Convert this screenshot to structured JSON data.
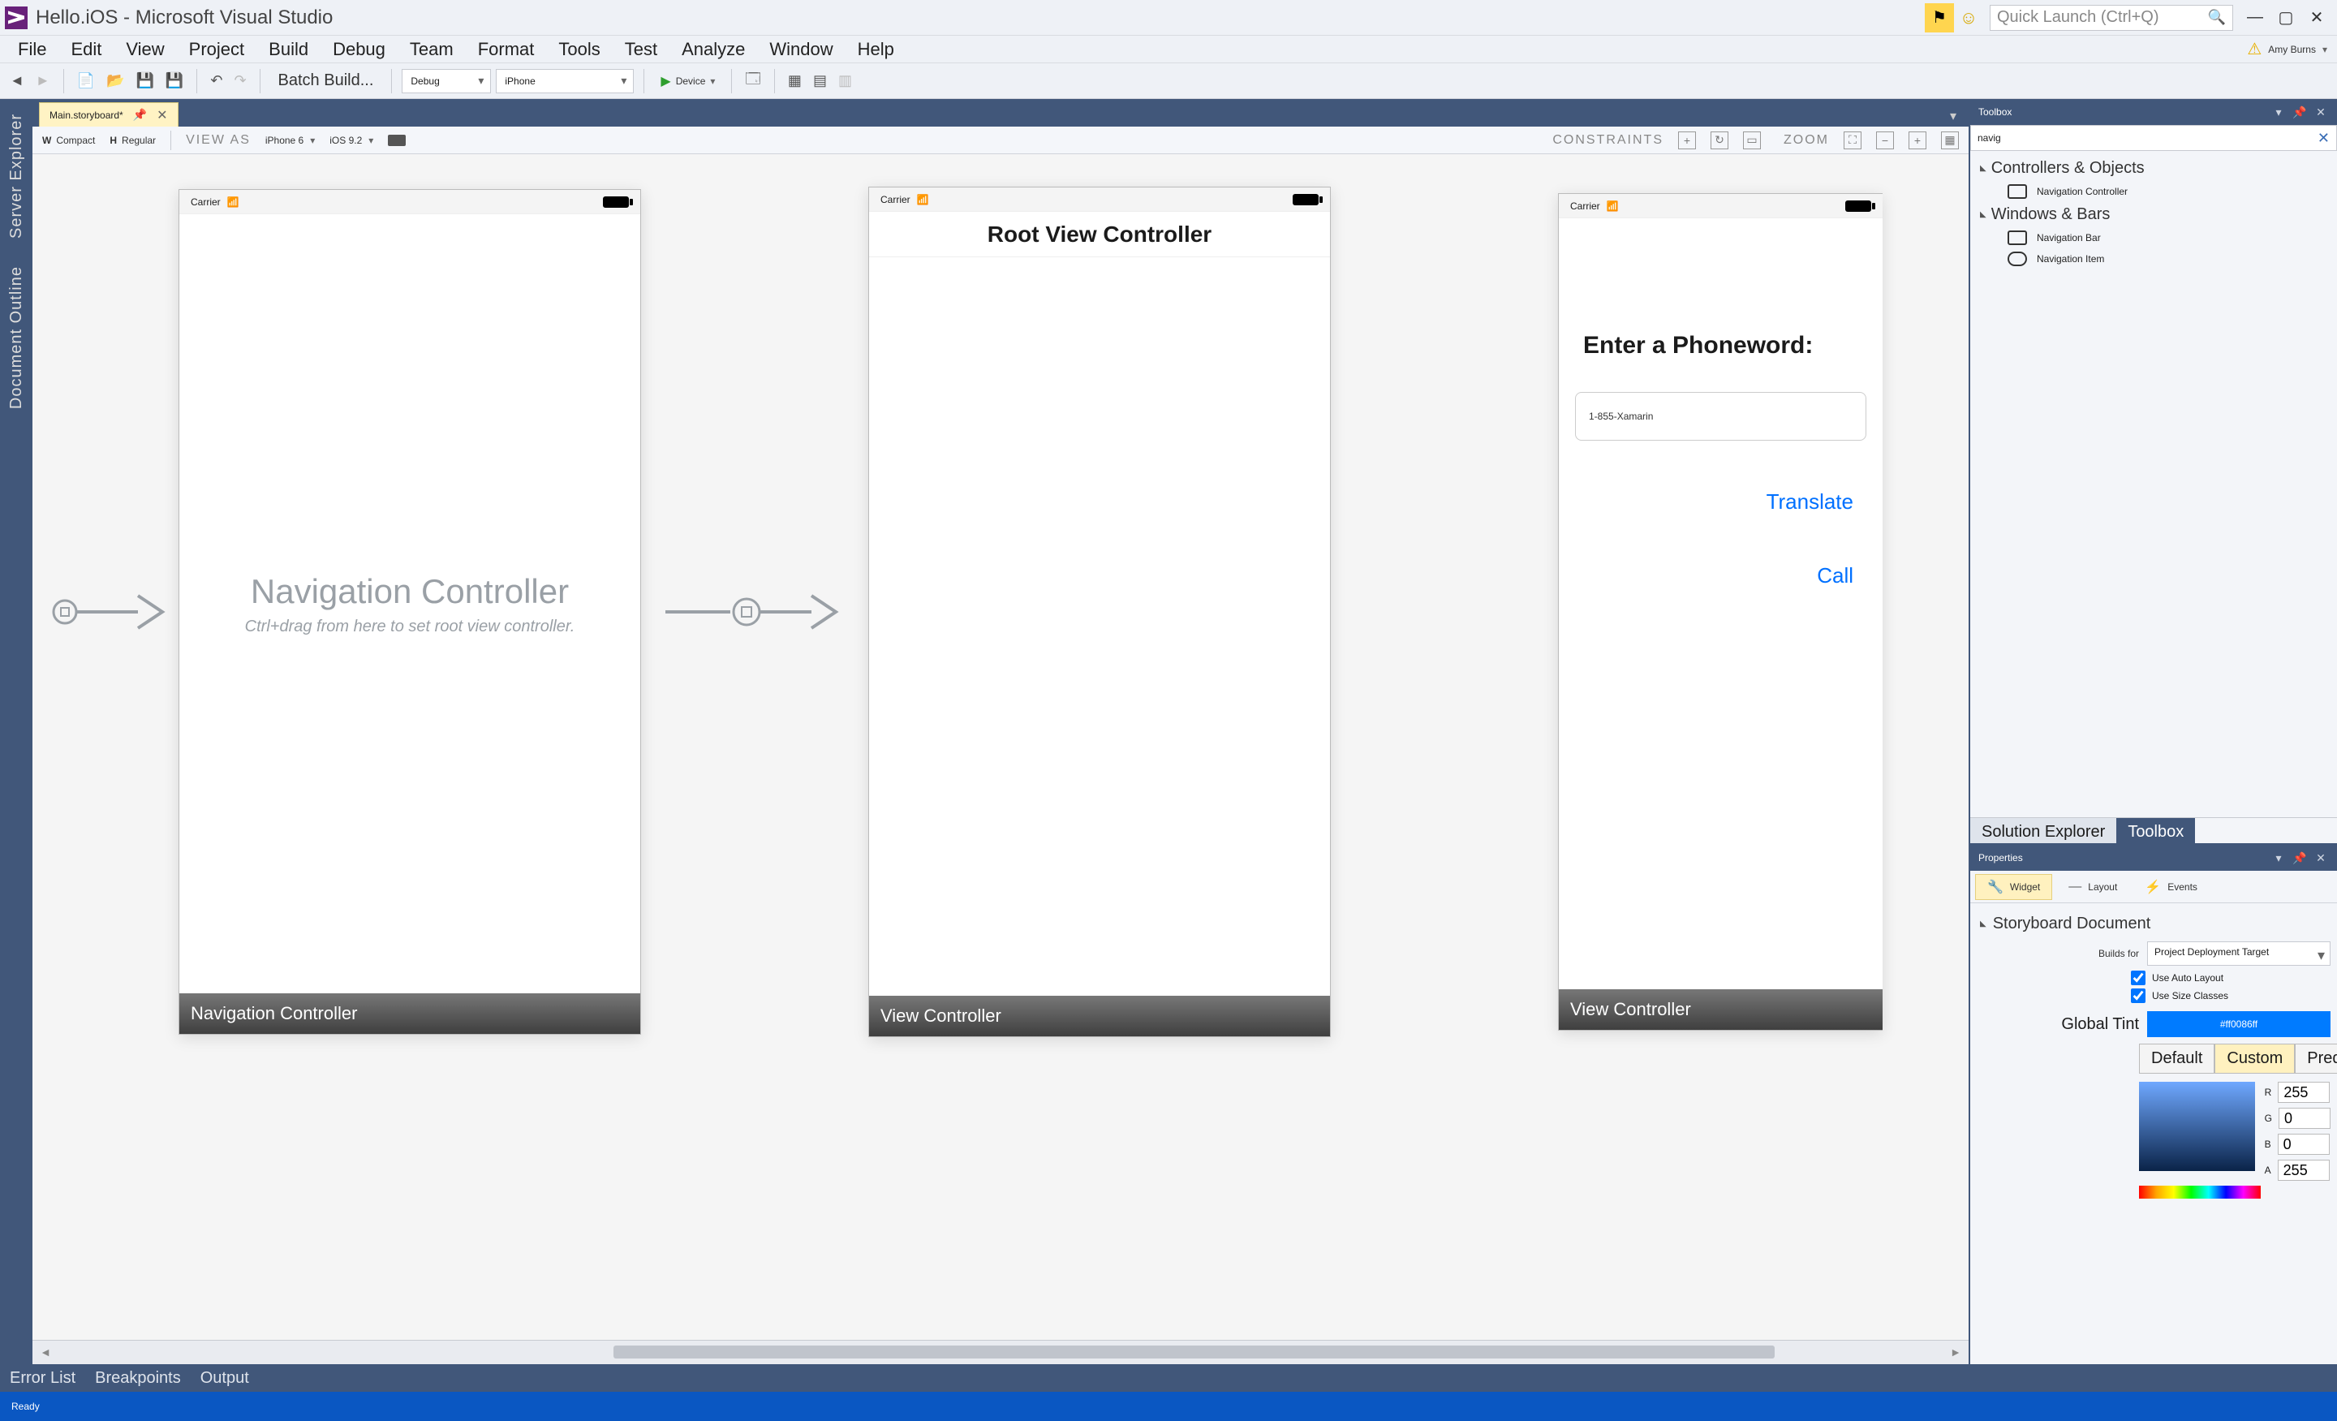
{
  "titlebar": {
    "title": "Hello.iOS - Microsoft Visual Studio",
    "quicklaunch_placeholder": "Quick Launch (Ctrl+Q)"
  },
  "menu": {
    "items": [
      "File",
      "Edit",
      "View",
      "Project",
      "Build",
      "Debug",
      "Team",
      "Format",
      "Tools",
      "Test",
      "Analyze",
      "Window",
      "Help"
    ],
    "user": "Amy Burns"
  },
  "toolbar": {
    "batch_build": "Batch Build...",
    "config": "Debug",
    "platform": "iPhone",
    "device": "Device"
  },
  "doctab": {
    "name": "Main.storyboard*"
  },
  "sizebar": {
    "w": "W",
    "wval": "Compact",
    "h": "H",
    "hval": "Regular",
    "viewas": "VIEW AS",
    "device": "iPhone 6",
    "os": "iOS 9.2",
    "constraints": "CONSTRAINTS",
    "zoom": "ZOOM"
  },
  "leftTabs": [
    "Server Explorer",
    "Document Outline"
  ],
  "scenes": {
    "navController": {
      "carrier": "Carrier",
      "placeholder_big": "Navigation Controller",
      "placeholder_small": "Ctrl+drag from here to set root view controller.",
      "footer": "Navigation Controller"
    },
    "rootVC": {
      "carrier": "Carrier",
      "title": "Root View Controller",
      "footer": "View Controller"
    },
    "phoneVC": {
      "carrier": "Carrier",
      "prompt": "Enter a Phoneword:",
      "textfield": "1-855-Xamarin",
      "translate": "Translate",
      "call": "Call",
      "footer": "View Controller"
    }
  },
  "toolbox": {
    "title": "Toolbox",
    "search": "navig",
    "cat1": "Controllers & Objects",
    "item1": "Navigation Controller",
    "cat2": "Windows & Bars",
    "item2": "Navigation Bar",
    "item3": "Navigation Item",
    "tab_se": "Solution Explorer",
    "tab_tb": "Toolbox"
  },
  "properties": {
    "title": "Properties",
    "tab_widget": "Widget",
    "tab_layout": "Layout",
    "tab_events": "Events",
    "section": "Storyboard Document",
    "builds_for_label": "Builds for",
    "builds_for_value": "Project Deployment Target",
    "autolayout": "Use Auto Layout",
    "sizeclasses": "Use Size Classes",
    "globaltint_label": "Global Tint",
    "globaltint_value": "#ff0086ff",
    "seg_default": "Default",
    "seg_custom": "Custom",
    "seg_predef": "Predefined",
    "r_label": "R",
    "r_val": "255",
    "g_label": "G",
    "g_val": "0",
    "b_label": "B",
    "b_val": "0",
    "a_label": "A",
    "a_val": "255"
  },
  "bottom": {
    "errorlist": "Error List",
    "breakpoints": "Breakpoints",
    "output": "Output"
  },
  "status": "Ready"
}
